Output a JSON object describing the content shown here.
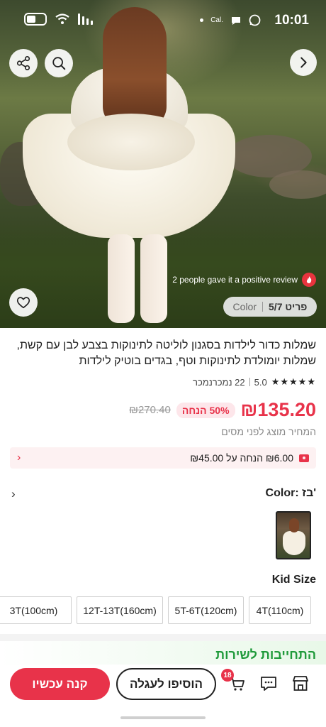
{
  "status_bar": {
    "time": "10:01",
    "carrier": "Cal.",
    "icons": [
      "battery-icon",
      "wifi-icon",
      "signal-icon",
      "dot-icon",
      "chat-icon",
      "whatsapp-icon"
    ]
  },
  "hero": {
    "nav_icons": [
      "share-icon",
      "search-icon",
      "chevron-right-icon"
    ],
    "review_text": "2 people gave it a positive review",
    "counter": {
      "page": "פריט 5/7",
      "label": "Color"
    },
    "favorite_icon": "heart-icon"
  },
  "product": {
    "title": "שמלות כדור לילדות בסגנון לוליטה לתינוקות בצבע לבן עם קשת, שמלות יומולדת לתינוקות וטף, בגדים בוטיק לילדות",
    "rating": "5.0",
    "sold_text": "22 נמכרנמכר",
    "price": "₪135.20",
    "discount": "50% הנחה",
    "old_price": "₪270.40",
    "tax_note": "המחיר מוצג לפני מסים"
  },
  "promo": {
    "text": "₪6.00 הנחה על ₪45.00"
  },
  "color": {
    "label": "Color: בז'"
  },
  "size": {
    "label": "Kid Size",
    "options": [
      "4T(110cm)",
      "5T-6T(120cm)",
      "12T-13T(160cm)",
      "3T(100cm)"
    ]
  },
  "service": {
    "text": "התחייבות לשירות"
  },
  "bottom_bar": {
    "buy_now": "קנה עכשיו",
    "add_to_cart": "הוסיפו לעגלה",
    "cart_count": "18"
  },
  "colors": {
    "accent": "#e8334a",
    "service_green": "#1f9a3a"
  }
}
